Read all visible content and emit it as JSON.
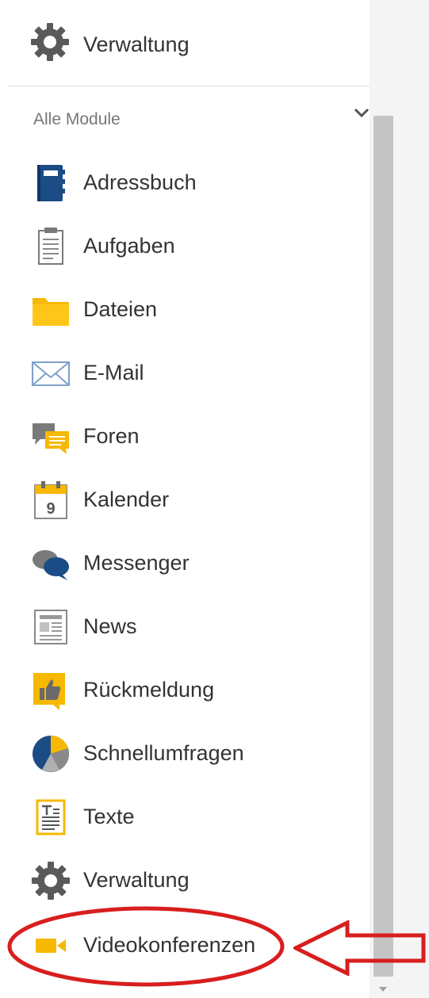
{
  "top": {
    "label": "Verwaltung",
    "icon": "gear-icon"
  },
  "section": {
    "title": "Alle Module",
    "toggle_icon": "chevron-down-icon"
  },
  "items": [
    {
      "label": "Adressbuch",
      "icon": "address-book-icon"
    },
    {
      "label": "Aufgaben",
      "icon": "clipboard-icon"
    },
    {
      "label": "Dateien",
      "icon": "folder-icon"
    },
    {
      "label": "E-Mail",
      "icon": "envelope-icon"
    },
    {
      "label": "Foren",
      "icon": "forum-icon"
    },
    {
      "label": "Kalender",
      "icon": "calendar-icon",
      "icon_text": "9"
    },
    {
      "label": "Messenger",
      "icon": "chat-bubbles-icon"
    },
    {
      "label": "News",
      "icon": "newspaper-icon"
    },
    {
      "label": "Rückmeldung",
      "icon": "thumbs-up-icon"
    },
    {
      "label": "Schnellumfragen",
      "icon": "pie-chart-icon"
    },
    {
      "label": "Texte",
      "icon": "text-document-icon"
    },
    {
      "label": "Verwaltung",
      "icon": "gear-icon"
    },
    {
      "label": "Videokonferenzen",
      "icon": "video-camera-icon"
    }
  ],
  "annotation": {
    "highlight_target": "Videokonferenzen",
    "color": "#d81e1e"
  },
  "colors": {
    "accent_blue": "#1b4c85",
    "accent_yellow": "#f6b800"
  }
}
